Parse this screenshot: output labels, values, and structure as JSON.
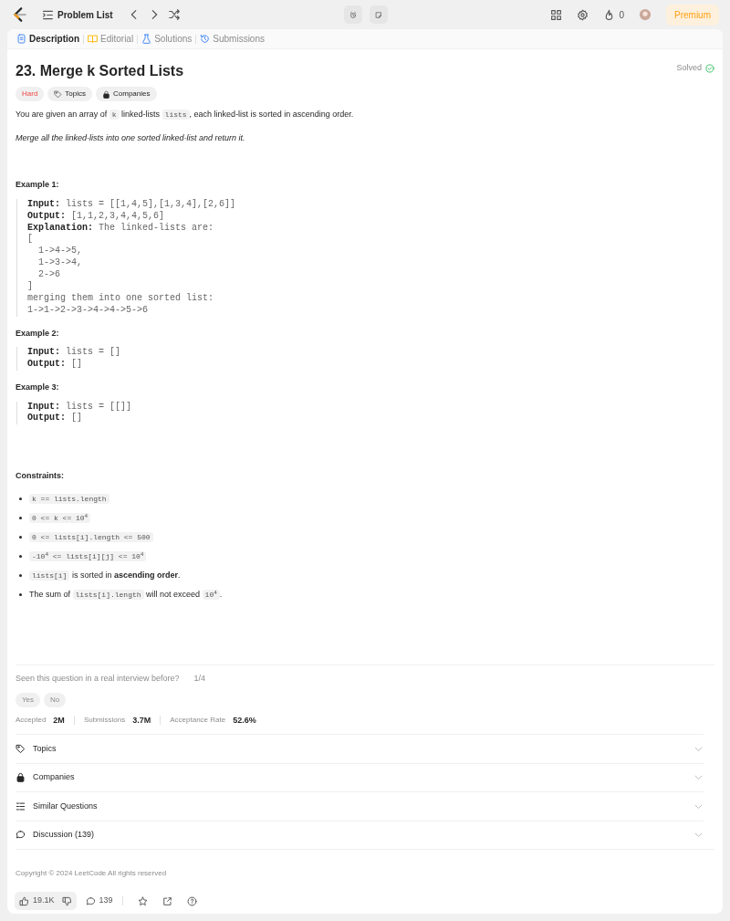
{
  "topbar": {
    "nav_title": "Problem List",
    "streak": "0",
    "premium": "Premium"
  },
  "tabs": [
    {
      "label": "Description",
      "kind": "description",
      "selected": true
    },
    {
      "label": "Editorial",
      "kind": "editorial",
      "selected": false
    },
    {
      "label": "Solutions",
      "kind": "solutions",
      "selected": false
    },
    {
      "label": "Submissions",
      "kind": "submissions",
      "selected": false
    }
  ],
  "problem": {
    "title": "23. Merge k Sorted Lists",
    "status": "Solved",
    "difficulty": "Hard",
    "tags": [
      {
        "label": "Topics",
        "kind": "tag"
      },
      {
        "label": "Companies",
        "kind": "lock"
      }
    ]
  },
  "statement": [
    {
      "kind": "plain",
      "parts": [
        {
          "kind": "text",
          "text": "You are given an array of "
        },
        {
          "kind": "code",
          "text": "k"
        },
        {
          "kind": "text",
          "text": " linked-lists "
        },
        {
          "kind": "code",
          "text": "lists"
        },
        {
          "kind": "text",
          "text": ", each linked-list is sorted in ascending order."
        }
      ]
    },
    {
      "kind": "emphasis",
      "parts": [
        {
          "kind": "text",
          "text": "Merge all the linked-lists into one sorted linked-list and return it."
        }
      ]
    }
  ],
  "examples": [
    {
      "title": "Example 1:",
      "lines": [
        {
          "label": "Input:",
          "value": "lists = [[1,4,5],[1,3,4],[2,6]]"
        },
        {
          "label": "Output:",
          "value": "[1,1,2,3,4,4,5,6]"
        },
        {
          "label": "Explanation:",
          "value": "The linked-lists are:"
        },
        {
          "value": "["
        },
        {
          "value": "  1->4->5,"
        },
        {
          "value": "  1->3->4,"
        },
        {
          "value": "  2->6"
        },
        {
          "value": "]"
        },
        {
          "value": "merging them into one sorted list:"
        },
        {
          "value": "1->1->2->3->4->4->5->6"
        }
      ]
    },
    {
      "title": "Example 2:",
      "lines": [
        {
          "label": "Input:",
          "value": "lists = []"
        },
        {
          "label": "Output:",
          "value": "[]"
        }
      ]
    },
    {
      "title": "Example 3:",
      "lines": [
        {
          "label": "Input:",
          "value": "lists = [[]]"
        },
        {
          "label": "Output:",
          "value": "[]"
        }
      ]
    }
  ],
  "constraints_title": "Constraints:",
  "constraints": [
    [
      {
        "kind": "code",
        "text": "k == lists.length"
      }
    ],
    [
      {
        "kind": "code",
        "text": "0 <= k <= 10$^{4}$"
      }
    ],
    [
      {
        "kind": "code",
        "text": "0 <= lists[i].length <= 500"
      }
    ],
    [
      {
        "kind": "code",
        "text": "-10$^{4}$ <= lists[i][j] <= 10$^{4}$"
      }
    ],
    [
      {
        "kind": "code",
        "text": "lists[i]"
      },
      {
        "kind": "text",
        "text": " is sorted in **ascending order**."
      }
    ],
    [
      {
        "kind": "text",
        "text": "The sum of "
      },
      {
        "kind": "code",
        "text": "lists[i].length"
      },
      {
        "kind": "text",
        "text": " will not exceed "
      },
      {
        "kind": "code",
        "text": "10$^{4}$"
      },
      {
        "kind": "text",
        "text": "."
      }
    ]
  ],
  "interview": {
    "question": "Seen this question in a real interview before?",
    "count": "1/4",
    "answers": [
      "Yes",
      "No"
    ]
  },
  "stats": [
    {
      "label": "Accepted",
      "value": "2M"
    },
    {
      "label": "Submissions",
      "value": "3.7M"
    },
    {
      "label": "Acceptance Rate",
      "value": "52.6%"
    }
  ],
  "sections": [
    {
      "label": "Topics",
      "kind": "tag"
    },
    {
      "label": "Companies",
      "kind": "lock"
    },
    {
      "label": "Similar Questions",
      "kind": "list"
    },
    {
      "label": "Discussion (139)",
      "kind": "chat"
    }
  ],
  "copyright": "Copyright © 2024 LeetCode All rights reserved",
  "footer": {
    "likes": "19.1K",
    "comments": "139"
  }
}
